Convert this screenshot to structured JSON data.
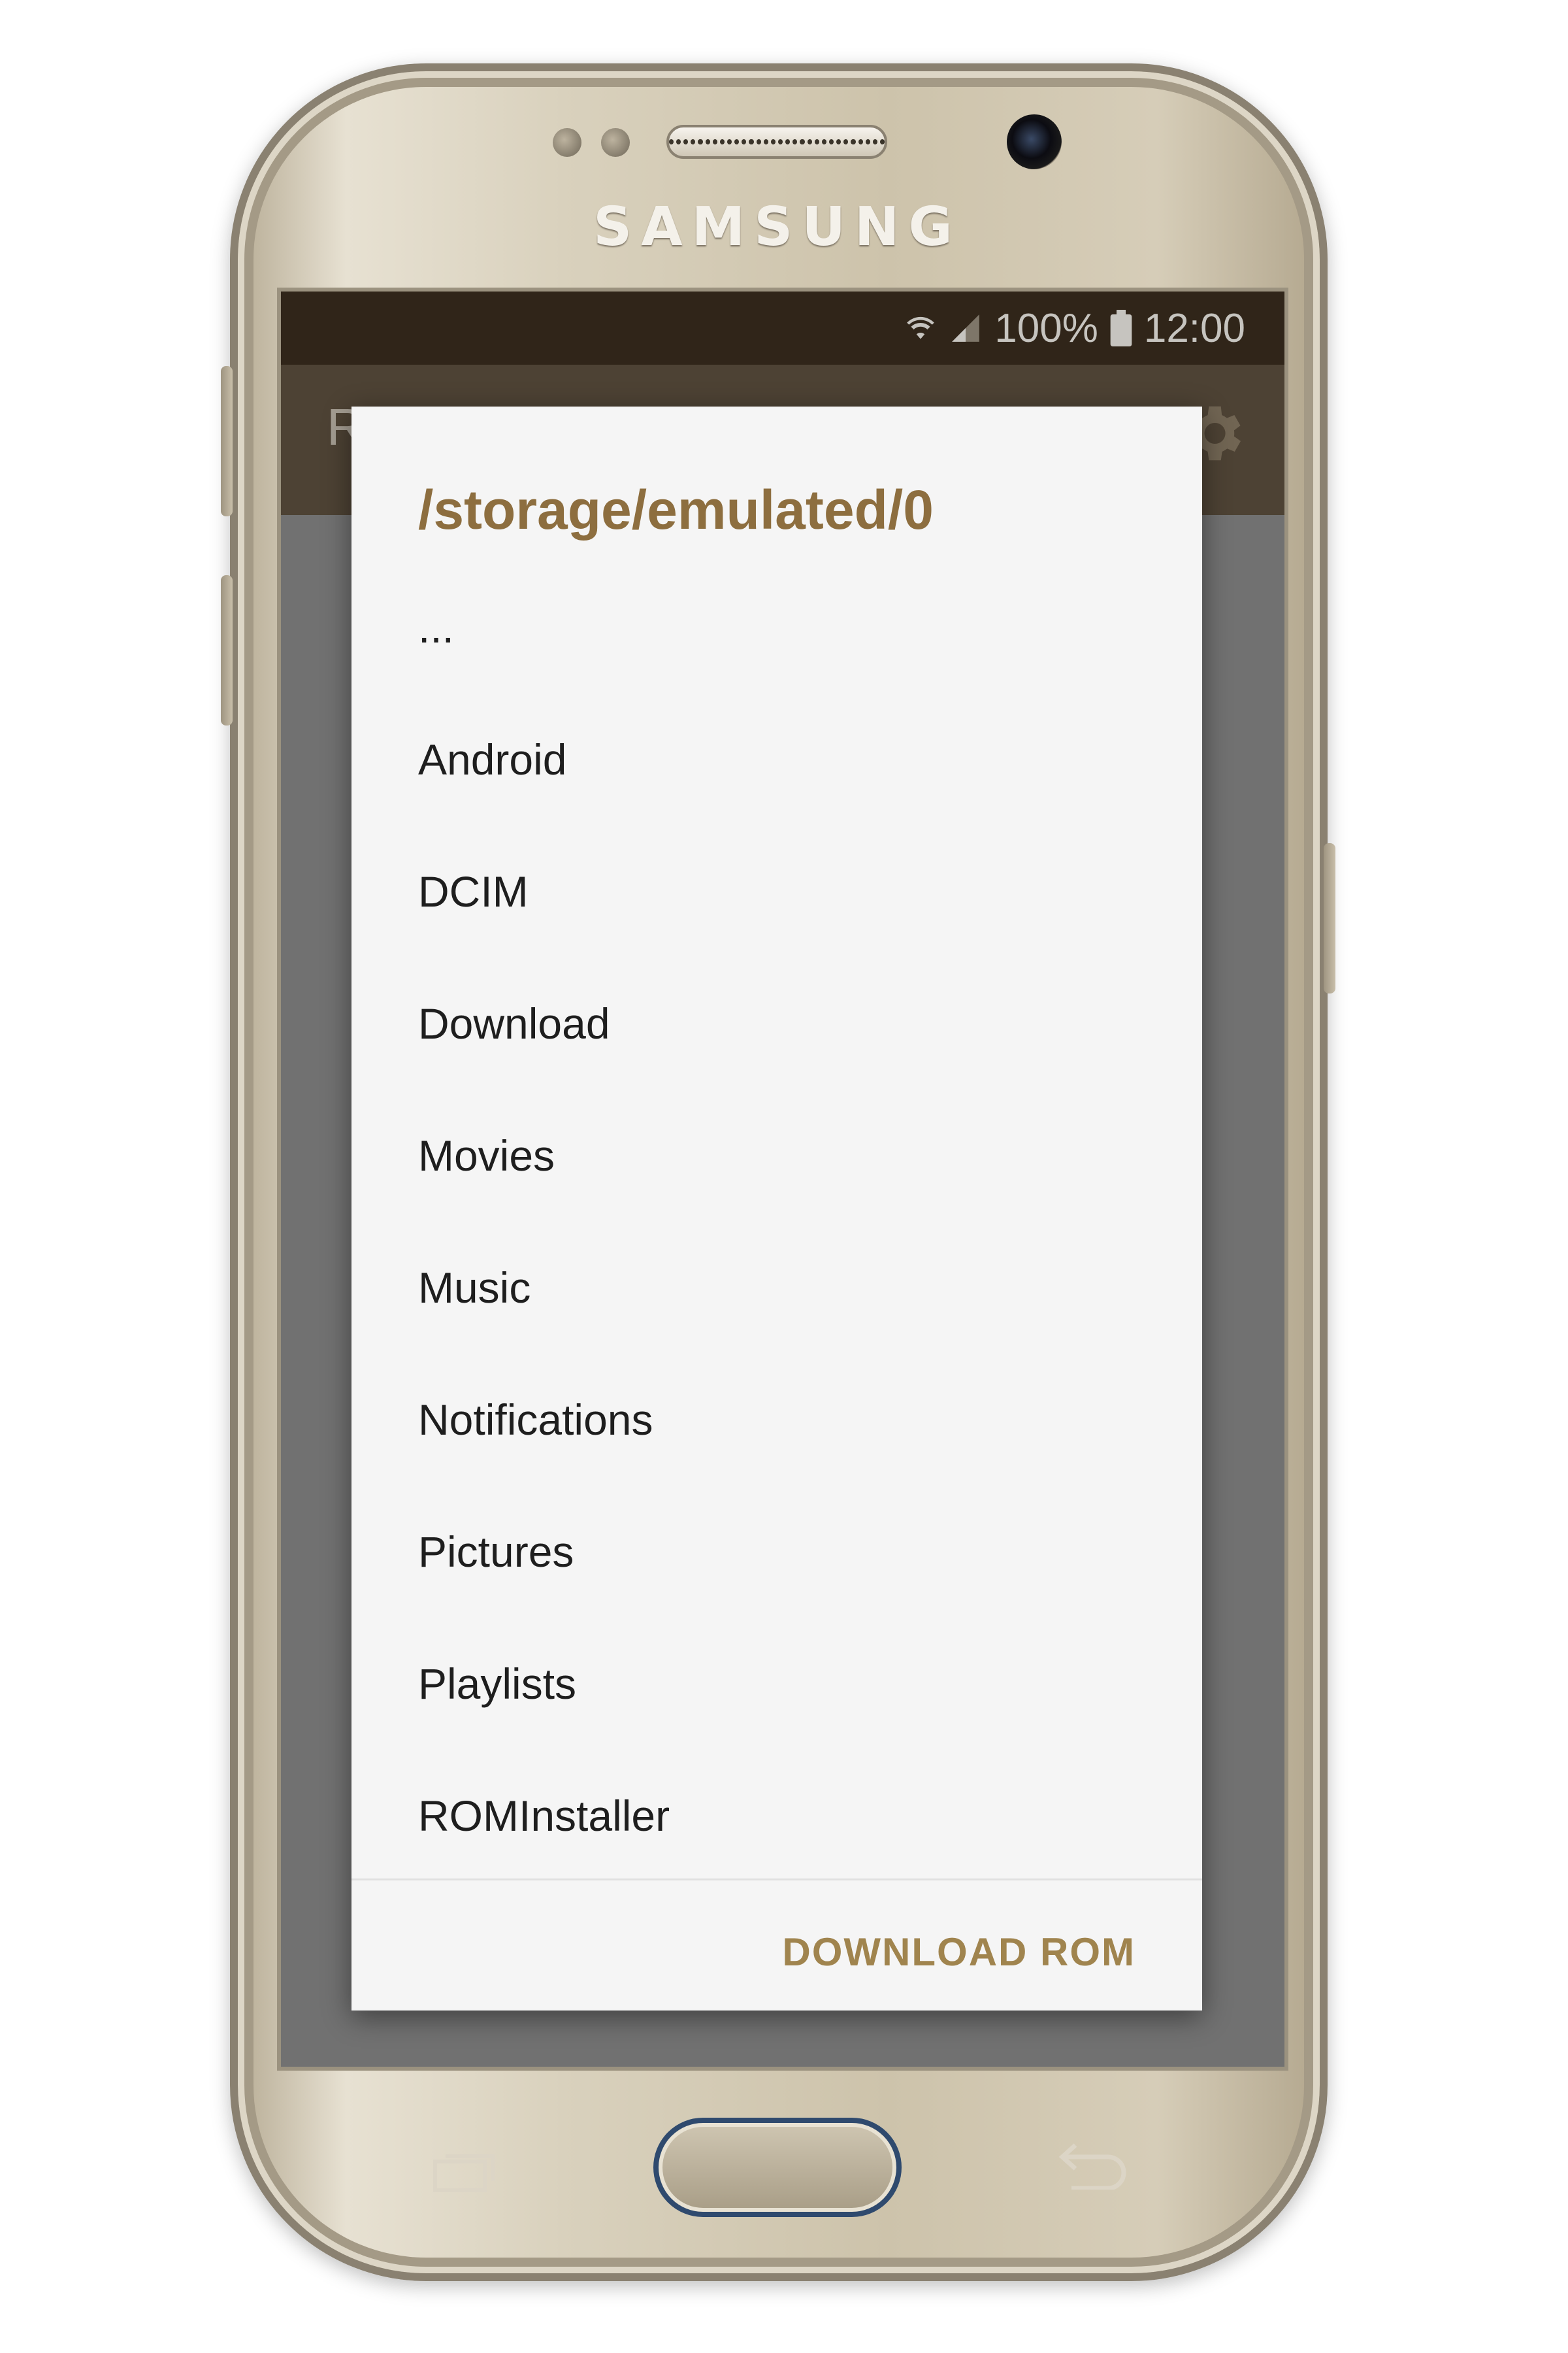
{
  "device": {
    "brand": "SAMSUNG"
  },
  "status_bar": {
    "battery": "100%",
    "time": "12:00"
  },
  "app_bar": {
    "title": "R"
  },
  "dialog": {
    "title": "/storage/emulated/0",
    "items": [
      {
        "label": "..."
      },
      {
        "label": "Android"
      },
      {
        "label": "DCIM"
      },
      {
        "label": "Download"
      },
      {
        "label": "Movies"
      },
      {
        "label": "Music"
      },
      {
        "label": "Notifications"
      },
      {
        "label": "Pictures"
      },
      {
        "label": "Playlists"
      },
      {
        "label": "ROMInstaller"
      }
    ],
    "action_label": "DOWNLOAD ROM"
  },
  "colors": {
    "accent": "#8d6e3f",
    "status_bar": "#3b2e1f",
    "app_bar": "#5f5140",
    "dialog_bg": "#f5f5f5"
  }
}
